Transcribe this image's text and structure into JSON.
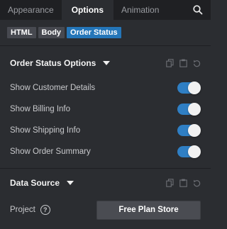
{
  "tabs": [
    {
      "label": "Appearance",
      "active": false
    },
    {
      "label": "Options",
      "active": true
    },
    {
      "label": "Animation",
      "active": false
    }
  ],
  "breadcrumbs": [
    "HTML",
    "Body",
    "Order Status"
  ],
  "order_status_section": {
    "title": "Order Status Options",
    "toggles": [
      {
        "label": "Show Customer Details",
        "on": true
      },
      {
        "label": "Show Billing Info",
        "on": true
      },
      {
        "label": "Show Shipping Info",
        "on": true
      },
      {
        "label": "Show Order Summary",
        "on": true
      }
    ]
  },
  "data_source_section": {
    "title": "Data Source",
    "project_label": "Project",
    "help_glyph": "?",
    "project_value": "Free Plan Store"
  },
  "colors": {
    "accent": "#2476b9",
    "toggle_on": "#2f7fc4",
    "background": "#2b2d31"
  }
}
